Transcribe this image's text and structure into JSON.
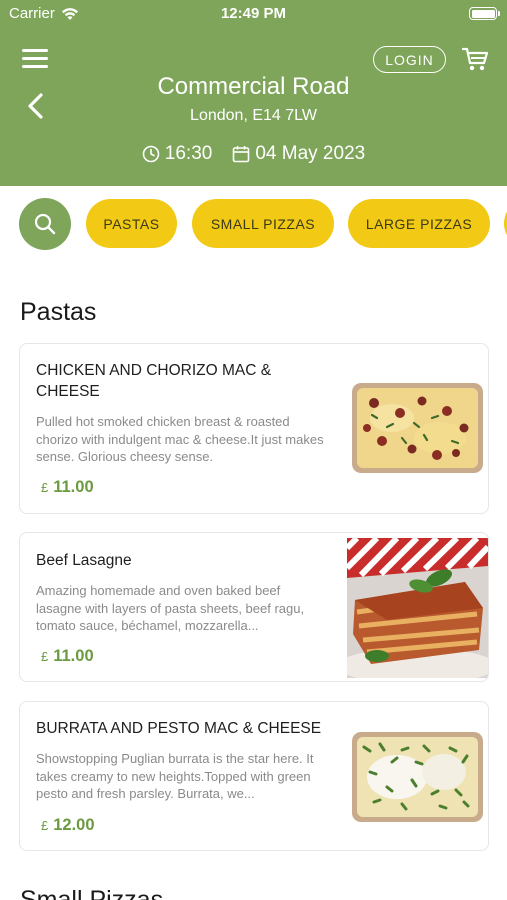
{
  "status_bar": {
    "carrier": "Carrier",
    "time": "12:49 PM"
  },
  "header": {
    "login_label": "LOGIN",
    "store_name": "Commercial Road",
    "store_address": "London, E14 7LW",
    "time": "16:30",
    "date": "04 May 2023"
  },
  "categories": [
    "PASTAS",
    "SMALL PIZZAS",
    "LARGE PIZZAS"
  ],
  "sections": [
    {
      "title": "Pastas",
      "items": [
        {
          "name": "CHICKEN AND CHORIZO MAC & CHEESE",
          "description": "Pulled hot smoked chicken breast & roasted chorizo with indulgent mac & cheese.It just makes sense. Glorious cheesy sense.",
          "currency": "£",
          "price": "11.00"
        },
        {
          "name": "Beef Lasagne",
          "description": "Amazing homemade and oven baked beef lasagne with layers of pasta sheets, beef ragu, tomato sauce, béchamel, mozzarella...",
          "currency": "£",
          "price": "11.00"
        },
        {
          "name": "BURRATA AND PESTO MAC & CHEESE",
          "description": "Showstopping Puglian burrata is the star here. It takes creamy to new heights.Topped with green pesto and fresh parsley. Burrata, we...",
          "currency": "£",
          "price": "12.00"
        }
      ]
    },
    {
      "title": "Small Pizzas"
    }
  ],
  "colors": {
    "header_green": "#7ea55a",
    "chip_yellow": "#f2c914",
    "price_green": "#6b9a40"
  },
  "icons": [
    "wifi-icon",
    "battery-icon",
    "menu-icon",
    "back-chevron-icon",
    "cart-icon",
    "clock-icon",
    "calendar-icon",
    "search-icon"
  ]
}
